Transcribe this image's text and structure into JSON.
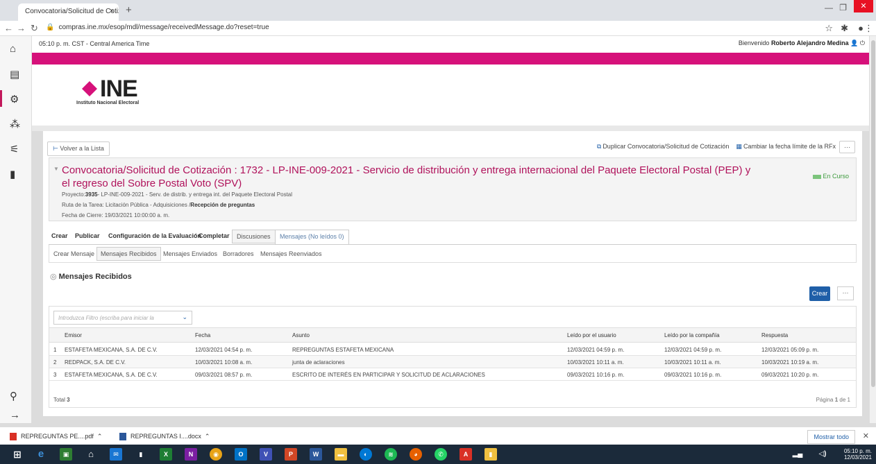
{
  "browser": {
    "tab_title": "Convocatoria/Solicitud de Cotiz",
    "tab_close": "×",
    "new_tab": "+",
    "url": "compras.ine.mx/esop/mdl/message/receivedMessage.do?reset=true"
  },
  "topbar": {
    "time": "05:10 p. m. CST - Central America Time",
    "welcome_prefix": "Bienvenido",
    "user": "Roberto Alejandro Medina"
  },
  "logo": {
    "name": "INE",
    "subtitle": "Instituto Nacional Electoral"
  },
  "actions": {
    "back": "Volver a la Lista",
    "duplicate": "Duplicar Convocatoria/Solicitud de Cotización",
    "change_date": "Cambiar la fecha límite de la RFx",
    "more": "···"
  },
  "rfx": {
    "title": "Convocatoria/Solicitud de Cotización : 1732 - LP-INE-009-2021 - Servicio de distribución y entrega internacional del Paquete Electoral Postal (PEP) y el regreso del Sobre Postal Voto (SPV)",
    "status": "En Curso",
    "project_label": "Proyecto:",
    "project_id": "3935",
    "project_text": "- LP-INE-009-2021 - Serv. de distrib. y entrega int. del Paquete Electoral Postal",
    "route_label": "Ruta de la Tarea: Licitación Pública - Adquisiciones /",
    "route_stage": "Recepción de preguntas",
    "close_date": "Fecha de Cierre: 19/03/2021 10:00:00 a. m."
  },
  "tabs_main": [
    "Crear",
    "Publicar",
    "Configuración de la Evaluación",
    "Completar",
    "Discusiones",
    "Mensajes (No leídos 0)"
  ],
  "tabs_sub": [
    "Crear Mensaje",
    "Mensajes Recibidos",
    "Mensajes Enviados",
    "Borradores",
    "Mensajes Reenviados"
  ],
  "section": {
    "title": "Mensajes Recibidos",
    "create": "Crear",
    "more": "···"
  },
  "table": {
    "filter_placeholder": "Introduzca Filtro (escriba para iniciar la",
    "headers": [
      "Emisor",
      "Fecha",
      "Asunto",
      "Leído por el usuario",
      "Leído por la compañía",
      "Respuesta"
    ],
    "rows": [
      {
        "n": "1",
        "emisor": "ESTAFETA MEXICANA, S.A. DE C.V.",
        "fecha": "12/03/2021 04:54 p. m.",
        "asunto": "REPREGUNTAS ESTAFETA MEXICANA",
        "usuario": "12/03/2021 04:59 p. m.",
        "compania": "12/03/2021 04:59 p. m.",
        "respuesta": "12/03/2021 05:09 p. m."
      },
      {
        "n": "2",
        "emisor": "REDPACK, S.A. DE C.V.",
        "fecha": "10/03/2021 10:08 a. m.",
        "asunto": "junta de aclaraciones",
        "usuario": "10/03/2021 10:11 a. m.",
        "compania": "10/03/2021 10:11 a. m.",
        "respuesta": "10/03/2021 10:19 a. m."
      },
      {
        "n": "3",
        "emisor": "ESTAFETA MEXICANA, S.A. DE C.V.",
        "fecha": "09/03/2021 08:57 p. m.",
        "asunto": "ESCRITO DE INTERÉS EN PARTICIPAR Y SOLICITUD DE ACLARACIONES",
        "usuario": "09/03/2021 10:16 p. m.",
        "compania": "09/03/2021 10:16 p. m.",
        "respuesta": "09/03/2021 10:20 p. m."
      }
    ],
    "total_label": "Total",
    "total_value": "3",
    "page_label": "Página",
    "page_current": "1",
    "page_of": "de 1"
  },
  "downloads": {
    "file1": "REPREGUNTAS PE....pdf",
    "file2": "REPREGUNTAS I....docx",
    "show_all": "Mostrar todo"
  },
  "taskbar": {
    "time": "05:10 p. m.",
    "date": "12/03/2021"
  },
  "colors": {
    "brand": "#d6117a",
    "title": "#b0125b",
    "primary": "#1f5fa8"
  }
}
